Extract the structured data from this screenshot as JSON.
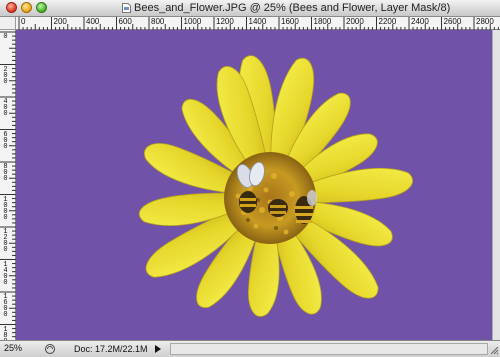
{
  "window": {
    "title": "Bees_and_Flower.JPG @ 25% (Bees and Flower, Layer Mask/8)",
    "controls": {
      "close": "close-icon",
      "minimize": "minimize-icon",
      "zoom": "zoom-icon"
    }
  },
  "rulers": {
    "horizontal_labels": [
      "0",
      "200",
      "400",
      "600",
      "800",
      "1000",
      "1200",
      "1400",
      "1600",
      "1800",
      "2000",
      "2200",
      "2400",
      "2600",
      "2800"
    ],
    "vertical_labels": [
      "0",
      "200",
      "400",
      "600",
      "800",
      "1000",
      "1200",
      "1400",
      "1600",
      "1800"
    ]
  },
  "canvas": {
    "background_color": "#7052a8",
    "image_subject": "flower-with-bees"
  },
  "statusbar": {
    "zoom": "25%",
    "doc_info": "Doc: 17.2M/22.1M",
    "menu_arrow_icon": "triangle-right-icon"
  }
}
